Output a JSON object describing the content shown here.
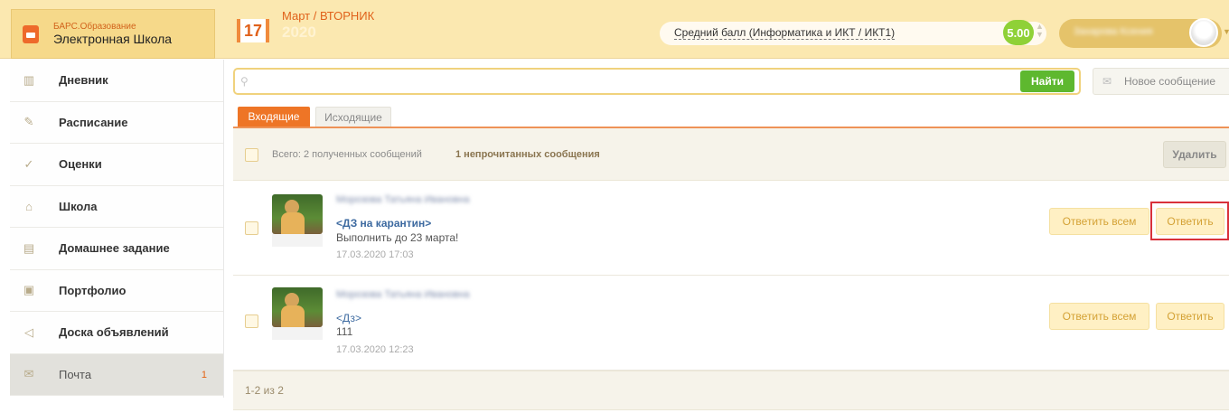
{
  "brand": {
    "small": "БАРС.Образование",
    "big": "Электронная Школа",
    "icon": "briefcase-icon"
  },
  "date": {
    "day": "17",
    "month_weekday": "Март / ВТОРНИК",
    "year": "2020"
  },
  "grade": {
    "label": "Средний балл (Информатика и ИКТ / ИКТ1)",
    "score": "5.00",
    "accent": "#8fd137"
  },
  "user": {
    "name": "Захарова Ксения",
    "icon": "avatar"
  },
  "sidebar": {
    "items": [
      {
        "label": "Дневник",
        "icon": "book-icon",
        "glyph": "▥"
      },
      {
        "label": "Расписание",
        "icon": "pin-icon",
        "glyph": "✎"
      },
      {
        "label": "Оценки",
        "icon": "check-icon",
        "glyph": "✓"
      },
      {
        "label": "Школа",
        "icon": "building-icon",
        "glyph": "⌂"
      },
      {
        "label": "Домашнее задание",
        "icon": "board-icon",
        "glyph": "▤"
      },
      {
        "label": "Портфолио",
        "icon": "portfolio-icon",
        "glyph": "▣"
      },
      {
        "label": "Доска объявлений",
        "icon": "megaphone-icon",
        "glyph": "◁"
      },
      {
        "label": "Почта",
        "icon": "mail-icon",
        "glyph": "✉",
        "count": "1",
        "active": true
      }
    ]
  },
  "search": {
    "placeholder": "",
    "value": "",
    "button": "Найти"
  },
  "new_message": "Новое сообщение",
  "tabs": {
    "inbox": "Входящие",
    "outbox": "Исходящие"
  },
  "list": {
    "total": "Всего: 2 полученных сообщений",
    "unread": "1 непрочитанных сообщения",
    "delete": "Удалить"
  },
  "messages": [
    {
      "sender": "Морозова Татьяна Ивановна",
      "subject": "<ДЗ на карантин>",
      "body": "Выполнить до 23 марта!",
      "date": "17.03.2020 17:03",
      "unread": true,
      "reply_all": "Ответить всем",
      "reply": "Ответить"
    },
    {
      "sender": "Морозова Татьяна Ивановна",
      "subject": "<Дз>",
      "body": "111",
      "date": "17.03.2020 12:23",
      "unread": false,
      "reply_all": "Ответить всем",
      "reply": "Ответить"
    }
  ],
  "pager": "1-2 из 2",
  "colors": {
    "topbar": "#fbe8b0",
    "orange": "#ee7526",
    "green": "#5eb82f",
    "highlight": "#d9313a"
  }
}
